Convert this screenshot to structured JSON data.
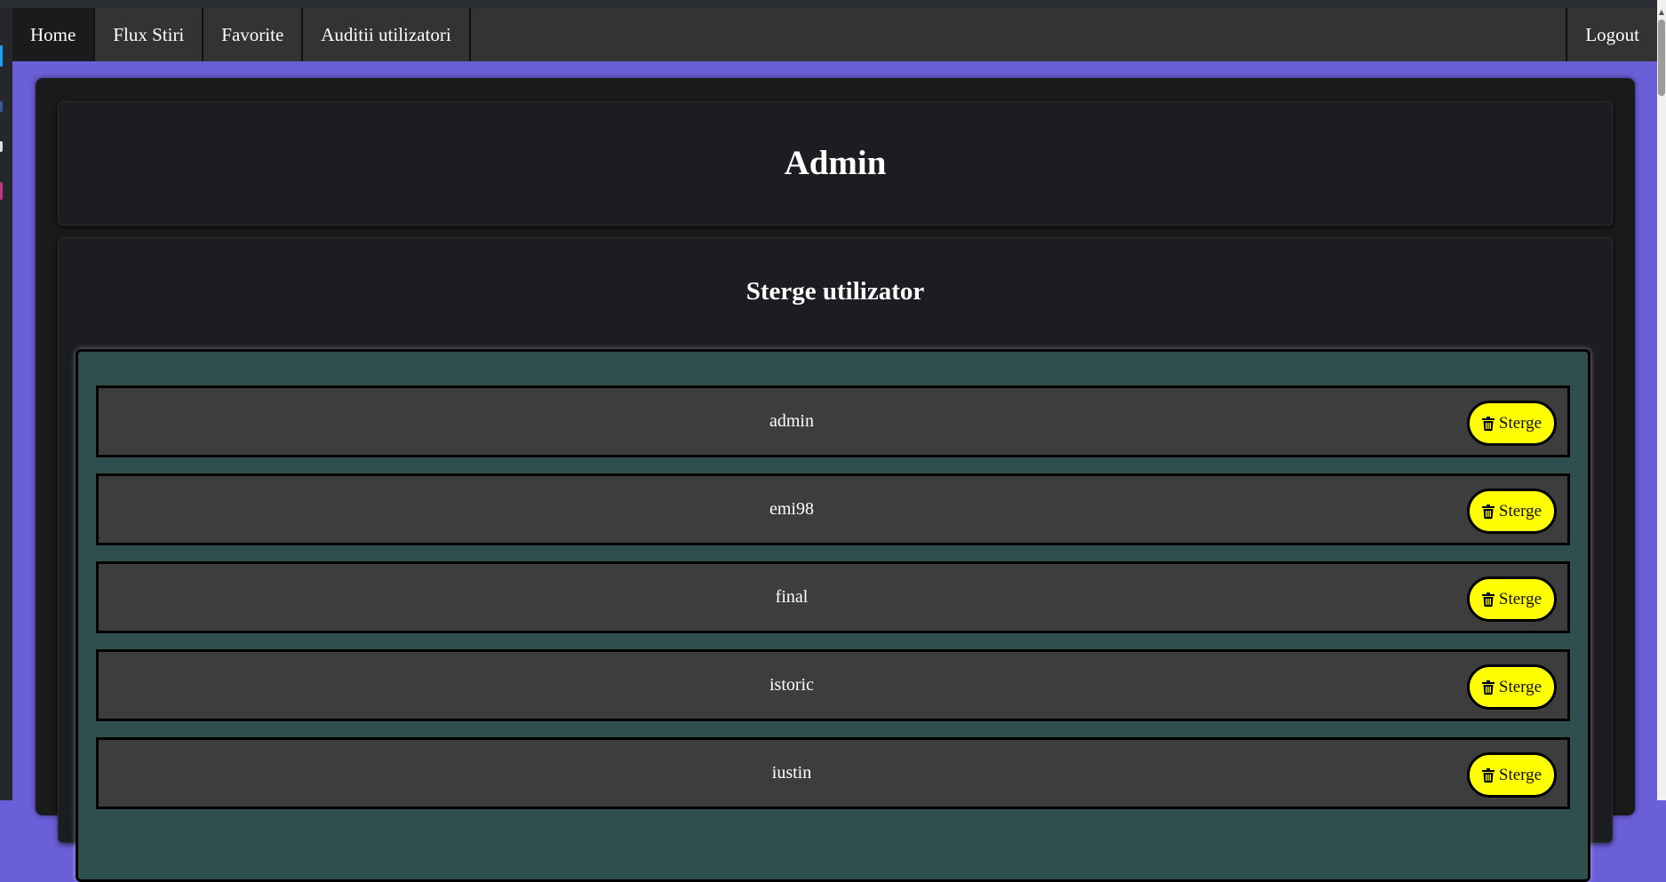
{
  "nav": {
    "items": [
      {
        "label": "Home"
      },
      {
        "label": "Flux Stiri"
      },
      {
        "label": "Favorite"
      },
      {
        "label": "Auditii utilizatori"
      }
    ],
    "logout_label": "Logout"
  },
  "header": {
    "title": "Admin"
  },
  "section": {
    "title": "Sterge utilizator"
  },
  "users": [
    {
      "name": "admin",
      "delete_label": "Sterge"
    },
    {
      "name": "emi98",
      "delete_label": "Sterge"
    },
    {
      "name": "final",
      "delete_label": "Sterge"
    },
    {
      "name": "istoric",
      "delete_label": "Sterge"
    },
    {
      "name": "iustin",
      "delete_label": "Sterge"
    }
  ],
  "icons": {
    "delete": "trash-icon"
  },
  "colors": {
    "page_background": "#6a5fd6",
    "navbar": "#333333",
    "card": "#1c1d21",
    "list_panel": "#2f4f4f",
    "row": "#3d3d3d",
    "delete_button": "#ffff00"
  }
}
